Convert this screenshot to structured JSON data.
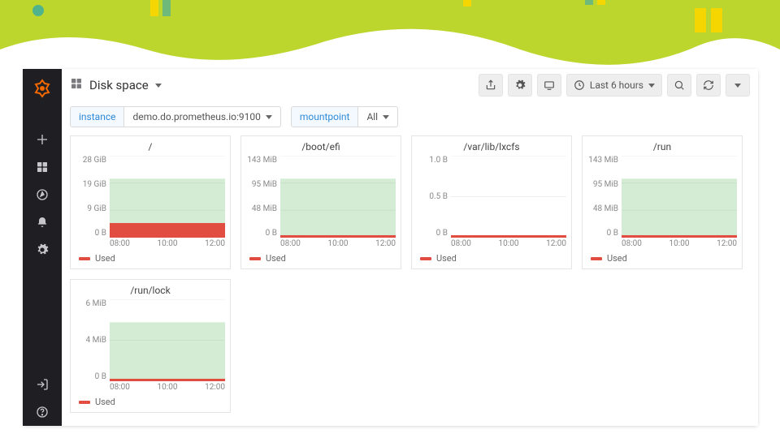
{
  "header": {
    "title": "Disk space",
    "time_range_label": "Last 6 hours"
  },
  "variables": {
    "instance": {
      "label": "instance",
      "value": "demo.do.prometheus.io:9100"
    },
    "mountpoint": {
      "label": "mountpoint",
      "value": "All"
    }
  },
  "x_ticks": [
    "08:00",
    "10:00",
    "12:00"
  ],
  "legend_label": "Used",
  "chart_data": [
    {
      "title": "/",
      "type": "area",
      "y_ticks": [
        "28 GiB",
        "19 GiB",
        "9 GiB",
        "0 B"
      ],
      "ylim_bytes": [
        0,
        28000000000
      ],
      "series": [
        {
          "name": "Used",
          "color": "#e24d42",
          "values_bytes": [
            5000000000,
            5000000000,
            5000000000
          ]
        }
      ],
      "x": [
        "08:00",
        "10:00",
        "12:00"
      ],
      "capacity_fill": true
    },
    {
      "title": "/boot/efi",
      "type": "area",
      "y_ticks": [
        "143 MiB",
        "95 MiB",
        "48 MiB",
        "0 B"
      ],
      "ylim_bytes": [
        0,
        150000000
      ],
      "series": [
        {
          "name": "Used",
          "color": "#e24d42",
          "values_bytes": [
            3000000,
            3000000,
            3000000
          ]
        }
      ],
      "x": [
        "08:00",
        "10:00",
        "12:00"
      ],
      "capacity_fill": true
    },
    {
      "title": "/var/lib/lxcfs",
      "type": "area",
      "y_ticks": [
        "1.0 B",
        "0.5 B",
        "0 B"
      ],
      "ylim_bytes": [
        0,
        1
      ],
      "series": [
        {
          "name": "Used",
          "color": "#e24d42",
          "values_bytes": [
            0,
            0,
            0
          ]
        }
      ],
      "x": [
        "08:00",
        "10:00",
        "12:00"
      ],
      "capacity_fill": false
    },
    {
      "title": "/run",
      "type": "area",
      "y_ticks": [
        "143 MiB",
        "95 MiB",
        "48 MiB",
        "0 B"
      ],
      "ylim_bytes": [
        0,
        150000000
      ],
      "series": [
        {
          "name": "Used",
          "color": "#e24d42",
          "values_bytes": [
            3500000,
            3500000,
            3500000
          ]
        }
      ],
      "x": [
        "08:00",
        "10:00",
        "12:00"
      ],
      "capacity_fill": true
    },
    {
      "title": "/run/lock",
      "type": "area",
      "y_ticks": [
        "6 MiB",
        "4 MiB",
        "0 B"
      ],
      "ylim_bytes": [
        0,
        6300000
      ],
      "series": [
        {
          "name": "Used",
          "color": "#e24d42",
          "values_bytes": [
            80000,
            80000,
            80000
          ]
        }
      ],
      "x": [
        "08:00",
        "10:00",
        "12:00"
      ],
      "capacity_fill": true
    }
  ]
}
